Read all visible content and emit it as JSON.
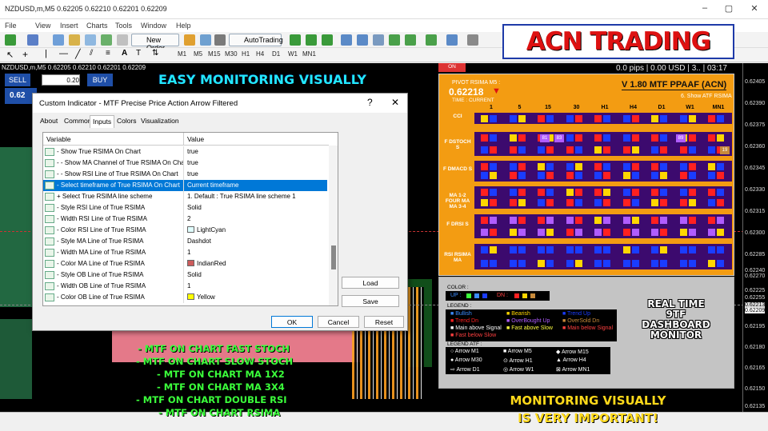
{
  "menu": [
    "File",
    "View",
    "Insert",
    "Charts",
    "Tools",
    "Window",
    "Help"
  ],
  "toolbar": {
    "new_order": "New Order",
    "autotrading": "AutoTrading"
  },
  "timeframes": [
    "M1",
    "M5",
    "M15",
    "M30",
    "H1",
    "H4",
    "D1",
    "W1",
    "MN1"
  ],
  "status": {
    "badge": "ON",
    "info": "0.0 pips | 0.00 USD | 3.. | 03:17"
  },
  "chart": {
    "header": "NZDUSD,m,M5  0.62205 0.62210 0.62201 0.62209",
    "price_labels": [
      "0.62405",
      "0.62390",
      "0.62375",
      "0.62360",
      "0.62345",
      "0.62330",
      "0.62315",
      "0.62300",
      "0.62285",
      "0.62270",
      "0.62255",
      "0.62240",
      "0.62225",
      "0.62213",
      "0.62209",
      "0.62195",
      "0.62180",
      "0.62165",
      "0.62150",
      "0.62135"
    ]
  },
  "trade": {
    "sell": "SELL",
    "buy": "BUY",
    "lots": "0.20",
    "sell_price": "0.62",
    "buy_price": "0.62"
  },
  "overlays": {
    "brand": "ACN TRADING",
    "easy": "EASY MONITORING VISUALLY",
    "features": [
      "- MTF ON CHART FAST STOCH",
      "- MTF ON CHART SLOW STOCH",
      "- MTF ON CHART MA 1X2",
      "- MTF ON CHART MA 3X4",
      "- MTF ON CHART DOUBLE RSI",
      "- MTF ON CHART RSIMA"
    ],
    "monitor_line1": "MONITORING VISUALLY",
    "monitor_line2": "IS VERY IMPORTANT!",
    "realtime": [
      "REAL TIME",
      "9TF",
      "DASHBOARD",
      "MONITOR"
    ]
  },
  "dialog": {
    "title": "Custom Indicator - MTF Precise Price Action Arrow Filtered",
    "help": "?",
    "close": "✕",
    "tabs": [
      "About",
      "Common",
      "Inputs",
      "Colors",
      "Visualization"
    ],
    "active_tab": "Inputs",
    "col_variable": "Variable",
    "col_value": "Value",
    "rows": [
      {
        "var": "- Show True RSIMA On Chart",
        "val": "true"
      },
      {
        "var": "- - Show MA Channel of True RSIMA On Chart",
        "val": "true"
      },
      {
        "var": "- - Show RSI Line of True RSIMA On Chart",
        "val": "true"
      },
      {
        "var": "- Select timeframe of True RSIMA On Chart",
        "val": "Current timeframe"
      },
      {
        "var": "+ Select True RSIMA line scheme",
        "val": "1. Default : True RSIMA line scheme 1"
      },
      {
        "var": "- Style RSI Line of True RSIMA",
        "val": "Solid"
      },
      {
        "var": "- Width RSI Line of True RSIMA",
        "val": "2"
      },
      {
        "var": "- Color RSI Line of True RSIMA",
        "val": "LightCyan"
      },
      {
        "var": "- Style MA Line of True RSIMA",
        "val": "Dashdot"
      },
      {
        "var": "- Width MA Line of True RSIMA",
        "val": "1"
      },
      {
        "var": "- Color MA Line of True RSIMA",
        "val": "IndianRed"
      },
      {
        "var": "- Style OB Line of True RSIMA",
        "val": "Solid"
      },
      {
        "var": "- Width OB Line of True RSIMA",
        "val": "1"
      },
      {
        "var": "- Color OB Line of True RSIMA",
        "val": "Yellow"
      }
    ],
    "swatches": {
      "LightCyan": "#e0ffff",
      "IndianRed": "#cd5c5c",
      "Yellow": "#ffff00"
    },
    "buttons": {
      "load": "Load",
      "save": "Save",
      "ok": "OK",
      "cancel": "Cancel",
      "reset": "Reset"
    }
  },
  "dashboard": {
    "pivot_label": "PIVOT RSIMA M5 :",
    "pivot_value": "0.62218",
    "time_label": "TIME : CURRENT",
    "version": "V 1.80 MTF PPAAF (ACN)",
    "show_label": "6. Show ATF RSIMA",
    "tf_headers": [
      "1",
      "5",
      "15",
      "30",
      "H1",
      "H4",
      "D1",
      "W1",
      "MN1"
    ],
    "rows": [
      "CCI",
      "F DSTOCH S",
      "F DMACD S",
      "MA 1-2 FOUR MA MA 3-4",
      "F DRSI S",
      "RSI RSIMA MA"
    ],
    "cell_numbers": [
      "81",
      "83",
      "89",
      "19"
    ]
  },
  "legend": {
    "color_title": "COLOR :",
    "up": "UP :",
    "dn": "DN :",
    "legend_title": "LEGEND :",
    "items": [
      {
        "text": "Bullish",
        "color": "#3b8cff"
      },
      {
        "text": "Bearish",
        "color": "#ffd700"
      },
      {
        "text": "Trend Up",
        "color": "#1a3cff"
      },
      {
        "text": "Trend Dn",
        "color": "#ff2020"
      },
      {
        "text": "OverBought Up",
        "color": "#b05cff"
      },
      {
        "text": "OverSold Dn",
        "color": "#c88a3a"
      },
      {
        "text": "Main above Signal",
        "color": "#ffffff"
      },
      {
        "text": "Fast above Slow",
        "color": "#ffff40"
      },
      {
        "text": "Main below Signal",
        "color": "#ff4040"
      },
      {
        "text": "Fast below Slow",
        "color": "#ff4040"
      }
    ],
    "atf_title": "LEGEND ATF :",
    "atf": [
      "Arrow M1",
      "Arrow M5",
      "Arrow M15",
      "Arrow M30",
      "Arrow H1",
      "Arrow H4",
      "Arrow D1",
      "Arrow W1",
      "Arrow MN1"
    ]
  }
}
